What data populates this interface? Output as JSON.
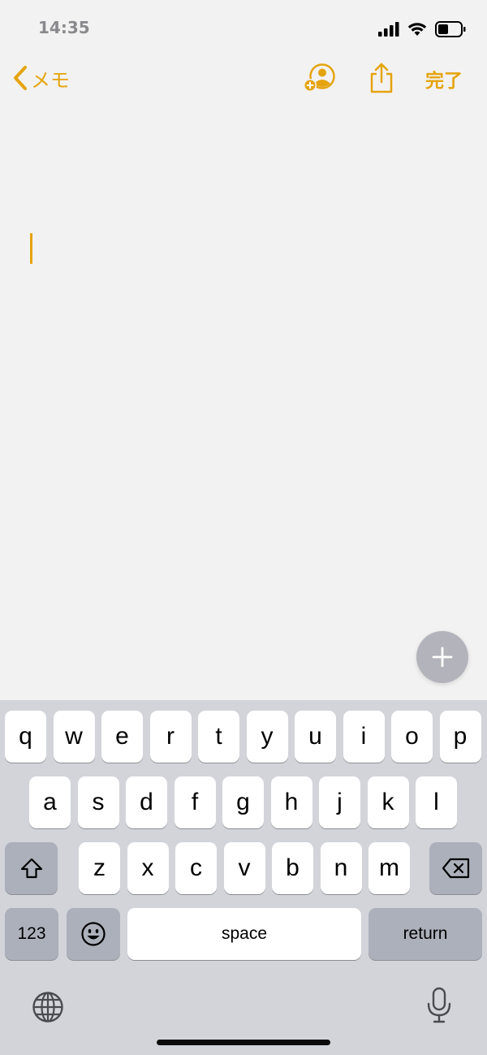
{
  "status": {
    "time": "14:35"
  },
  "nav": {
    "back_label": "メモ",
    "done_label": "完了"
  },
  "colors": {
    "accent": "#e5a40e",
    "keyboard_bg": "#d2d4da",
    "key_bg": "#ffffff",
    "fn_key_bg": "#acb0ba"
  },
  "keyboard": {
    "row1": [
      "q",
      "w",
      "e",
      "r",
      "t",
      "y",
      "u",
      "i",
      "o",
      "p"
    ],
    "row2": [
      "a",
      "s",
      "d",
      "f",
      "g",
      "h",
      "j",
      "k",
      "l"
    ],
    "row3": [
      "z",
      "x",
      "c",
      "v",
      "b",
      "n",
      "m"
    ],
    "numbers_label": "123",
    "space_label": "space",
    "return_label": "return"
  },
  "icons": [
    "chevron-left-icon",
    "add-person-icon",
    "share-icon",
    "plus-icon",
    "shift-icon",
    "backspace-icon",
    "emoji-icon",
    "globe-icon",
    "microphone-icon"
  ]
}
